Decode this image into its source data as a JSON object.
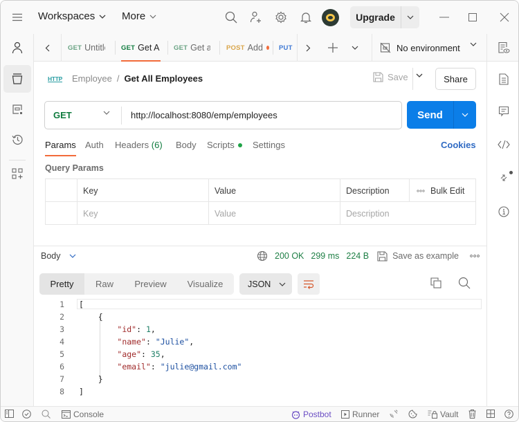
{
  "titlebar": {
    "menu_icon": "hamburger-menu-icon",
    "workspaces_label": "Workspaces",
    "more_label": "More",
    "upgrade_label": "Upgrade",
    "icons": [
      "search-icon",
      "invite-user-icon",
      "gear-icon",
      "bell-icon"
    ]
  },
  "left_sidebar": {
    "items": [
      {
        "icon": "user-icon",
        "active": false
      },
      {
        "icon": "collections-icon",
        "active": true
      },
      {
        "icon": "environments-icon",
        "active": false
      },
      {
        "icon": "history-icon",
        "active": false
      },
      {
        "icon": "add-apps-icon",
        "active": false
      }
    ]
  },
  "tabs": [
    {
      "method": "GET",
      "label": "Untitle",
      "active": false
    },
    {
      "method": "GET",
      "label": "Get A",
      "active": true
    },
    {
      "method": "GET",
      "label": "Get al",
      "active": false
    },
    {
      "method": "POST",
      "label": "Add",
      "active": false,
      "unsaved": true
    },
    {
      "method": "PUT",
      "label": "",
      "active": false
    }
  ],
  "environment": {
    "label": "No environment"
  },
  "breadcrumb": {
    "type_badge": "HTTP",
    "parent": "Employee",
    "separator": "/",
    "current": "Get All Employees"
  },
  "actions": {
    "save_label": "Save",
    "share_label": "Share"
  },
  "request": {
    "method": "GET",
    "url": "http://localhost:8080/emp/employees",
    "send_label": "Send"
  },
  "request_tabs": [
    {
      "label": "Params",
      "active": true
    },
    {
      "label": "Auth"
    },
    {
      "label": "Headers",
      "count": "(6)"
    },
    {
      "label": "Body"
    },
    {
      "label": "Scripts",
      "dot": true
    },
    {
      "label": "Settings"
    }
  ],
  "cookies_label": "Cookies",
  "query_params": {
    "title": "Query Params",
    "headers": [
      "Key",
      "Value",
      "Description"
    ],
    "bulk_edit_label": "Bulk Edit",
    "placeholders": [
      "Key",
      "Value",
      "Description"
    ]
  },
  "response": {
    "body_label": "Body",
    "status": "200 OK",
    "time": "299 ms",
    "size": "224 B",
    "save_example_label": "Save as example",
    "view_tabs": [
      "Pretty",
      "Raw",
      "Preview",
      "Visualize"
    ],
    "active_view": "Pretty",
    "format": "JSON",
    "lines": [
      {
        "n": "1",
        "text": "["
      },
      {
        "n": "2",
        "text": "    {"
      },
      {
        "n": "3",
        "key": "\"id\"",
        "value": "1",
        "vtype": "n",
        "trail": ","
      },
      {
        "n": "4",
        "key": "\"name\"",
        "value": "\"Julie\"",
        "vtype": "s",
        "trail": ","
      },
      {
        "n": "5",
        "key": "\"age\"",
        "value": "35",
        "vtype": "n",
        "trail": ","
      },
      {
        "n": "6",
        "key": "\"email\"",
        "value": "\"julie@gmail.com\"",
        "vtype": "s",
        "trail": ""
      },
      {
        "n": "7",
        "text": "    }"
      },
      {
        "n": "8",
        "text": "]"
      }
    ]
  },
  "statusbar": {
    "console_label": "Console",
    "postbot_label": "Postbot",
    "runner_label": "Runner",
    "vault_label": "Vault"
  }
}
